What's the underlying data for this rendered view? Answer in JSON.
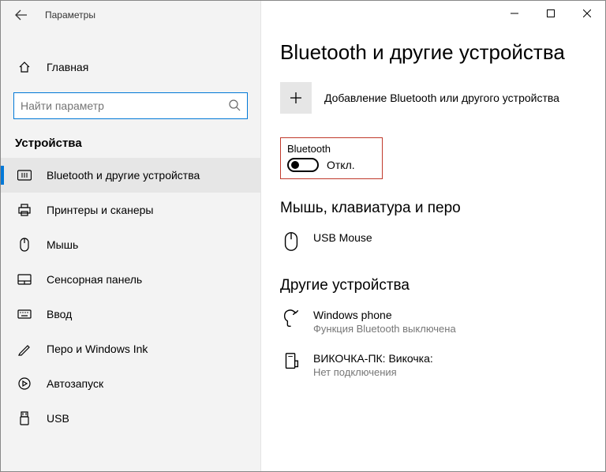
{
  "app_title": "Параметры",
  "home_label": "Главная",
  "search_placeholder": "Найти параметр",
  "category": "Устройства",
  "nav": [
    {
      "id": "bluetooth",
      "label": "Bluetooth и другие устройства",
      "active": true
    },
    {
      "id": "printers",
      "label": "Принтеры и сканеры",
      "active": false
    },
    {
      "id": "mouse",
      "label": "Мышь",
      "active": false
    },
    {
      "id": "touchpad",
      "label": "Сенсорная панель",
      "active": false
    },
    {
      "id": "typing",
      "label": "Ввод",
      "active": false
    },
    {
      "id": "pen",
      "label": "Перо и Windows Ink",
      "active": false
    },
    {
      "id": "autoplay",
      "label": "Автозапуск",
      "active": false
    },
    {
      "id": "usb",
      "label": "USB",
      "active": false
    }
  ],
  "page_title": "Bluetooth и другие устройства",
  "add_label": "Добавление Bluetooth или другого устройства",
  "bt_title": "Bluetooth",
  "bt_state": "Откл.",
  "mouse_section": "Мышь, клавиатура и перо",
  "mouse_device": "USB Mouse",
  "other_section": "Другие устройства",
  "other_devices": [
    {
      "name": "Windows phone",
      "sub": "Функция Bluetooth выключена"
    },
    {
      "name": "ВИКОЧКА-ПК: Викочка:",
      "sub": "Нет подключения"
    }
  ]
}
